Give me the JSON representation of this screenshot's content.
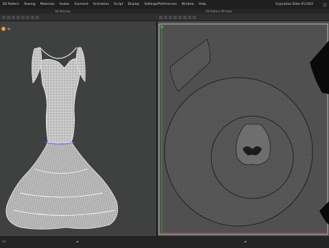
{
  "menu": [
    "3D Pattern",
    "Sewing",
    "Materials",
    "Avatar",
    "Garment",
    "Animation",
    "Script",
    "Display",
    "Settings/Preferences",
    "Window",
    "Help"
  ],
  "menu_prefix": "3D Pattern",
  "expiration": "Expiration Date 01/10/2",
  "window_titles": {
    "left": "3D Window",
    "right": "2D Pattern Window"
  },
  "status": {
    "left": "Ver"
  },
  "colors": {
    "accent": "#f0a020",
    "viewport3d": "#3f4040",
    "viewport2d": "#505050",
    "mesh": "#e8e8e8"
  },
  "icons": {
    "snap": "orange-gear-icon",
    "close": "close-icon",
    "maximize": "maximize-icon",
    "minimize": "minimize-icon"
  }
}
